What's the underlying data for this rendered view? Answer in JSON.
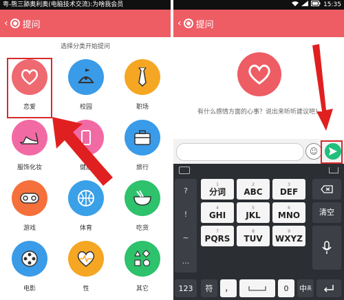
{
  "left": {
    "status_text": "粤-熊三舔奥利奥(电脑技术交流):为啥我会员",
    "title": "提问",
    "hint": "选择分类开始提问",
    "categories": [
      {
        "label": "恋爱",
        "color": "#ef6970",
        "icon": "heart-icon",
        "selected": true
      },
      {
        "label": "校园",
        "color": "#3a9be8",
        "icon": "school-icon"
      },
      {
        "label": "职场",
        "color": "#f5a623",
        "icon": "necktie-icon"
      },
      {
        "label": "服饰化妆",
        "color": "#f26aa3",
        "icon": "high-heel-icon"
      },
      {
        "label": "健康",
        "color": "#f26aa3",
        "icon": "health-icon"
      },
      {
        "label": "旅行",
        "color": "#3a9be8",
        "icon": "suitcase-icon"
      },
      {
        "label": "游戏",
        "color": "#f5703a",
        "icon": "gamepad-icon"
      },
      {
        "label": "体育",
        "color": "#3aa0e8",
        "icon": "basketball-icon"
      },
      {
        "label": "吃货",
        "color": "#2dc26b",
        "icon": "bowl-icon"
      },
      {
        "label": "电影",
        "color": "#3a9be8",
        "icon": "film-reel-icon"
      },
      {
        "label": "性",
        "color": "#f5a623",
        "icon": "heartbeat-icon"
      },
      {
        "label": "其它",
        "color": "#2dc26b",
        "icon": "shapes-icon"
      }
    ]
  },
  "right": {
    "status_time": "15:35",
    "title": "提问",
    "prompt": "有什么感情方面的心事？说出来听听建议吧！",
    "emoji_icon": "smiley-icon",
    "send_icon": "send-icon",
    "keyboard": {
      "side_keys": [
        "?",
        "!",
        "~",
        "..."
      ],
      "keys": [
        {
          "sub": "1",
          "main": "分词"
        },
        {
          "sub": "2",
          "main": "ABC"
        },
        {
          "sub": "3",
          "main": "DEF"
        },
        {
          "sub": "4",
          "main": "GHI"
        },
        {
          "sub": "5",
          "main": "JKL"
        },
        {
          "sub": "6",
          "main": "MNO"
        },
        {
          "sub": "7",
          "main": "PQRS"
        },
        {
          "sub": "8",
          "main": "TUV"
        },
        {
          "sub": "9",
          "main": "WXYZ"
        }
      ],
      "clear_label": "清空",
      "bottom": {
        "num": "123",
        "sym": "符",
        "comma": "，",
        "zero": "0",
        "lang": "中",
        "lang_sub": "英"
      }
    }
  },
  "colors": {
    "brand": "#ee5c64",
    "highlight": "#d8282a",
    "send": "#1fbf7c"
  }
}
